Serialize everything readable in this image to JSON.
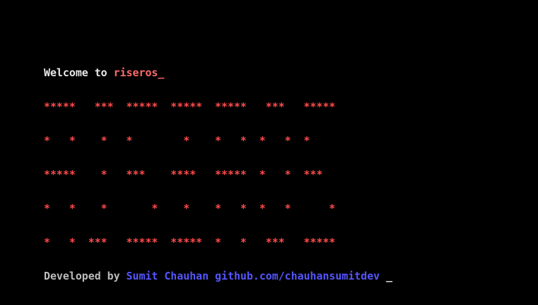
{
  "terminal": {
    "welcome_text": "Welcome to ",
    "os_name": "riseros_",
    "banner_lines": [
      "*****   ***  *****  *****  *****   ***   *****",
      "*   *    *   *        *    *   *  *   *  *",
      "*****    *   ***    ****   *****  *   *  ***",
      "*   *    *       *    *    *   *  *   *      *",
      "*   *  ***   *****  *****  *   *   ***   *****"
    ],
    "developed_by_text": "Developed by ",
    "author_name": "Sumit Chauhan",
    "github_text": " github.com/chauhansumitdev",
    "cursor": " _"
  },
  "colors": {
    "background": "#000000",
    "text": "#e8e8e8",
    "brand": "#ff6b6b",
    "banner": "#ff4b4b",
    "author": "#5555ff"
  }
}
